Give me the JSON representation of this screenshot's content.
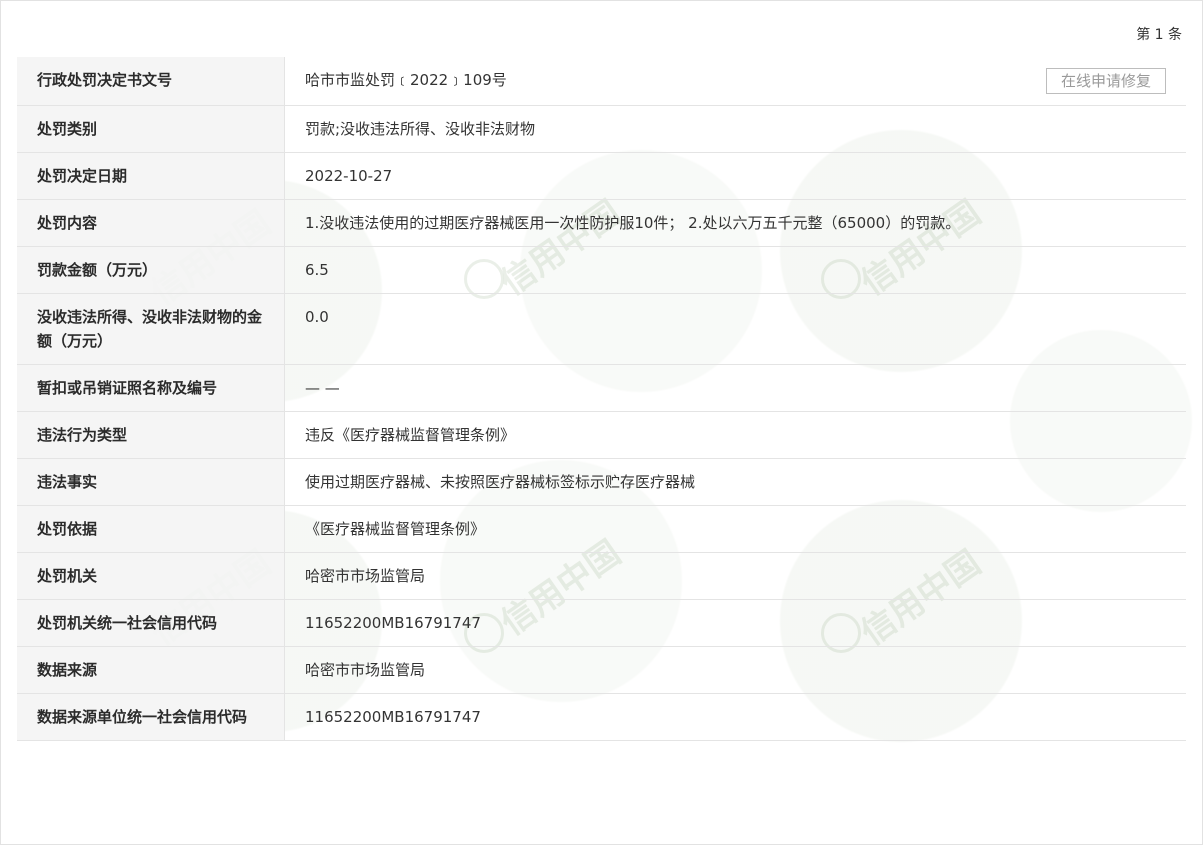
{
  "page_indicator": "第 1 条",
  "watermark_text": "信用中国",
  "repair_button_label": "在线申请修复",
  "rows": [
    {
      "label": "行政处罚决定书文号",
      "value": "哈市市监处罚﹝2022﹞109号"
    },
    {
      "label": "处罚类别",
      "value": "罚款;没收违法所得、没收非法财物"
    },
    {
      "label": "处罚决定日期",
      "value": "2022-10-27"
    },
    {
      "label": "处罚内容",
      "value": "1.没收违法使用的过期医疗器械医用一次性防护服10件； 2.处以六万五千元整（65000）的罚款。"
    },
    {
      "label": "罚款金额（万元）",
      "value": "6.5"
    },
    {
      "label": "没收违法所得、没收非法财物的金额（万元）",
      "value": "0.0"
    },
    {
      "label": "暂扣或吊销证照名称及编号",
      "value": "— —"
    },
    {
      "label": "违法行为类型",
      "value": "违反《医疗器械监督管理条例》"
    },
    {
      "label": "违法事实",
      "value": "使用过期医疗器械、未按照医疗器械标签标示贮存医疗器械"
    },
    {
      "label": "处罚依据",
      "value": "《医疗器械监督管理条例》"
    },
    {
      "label": "处罚机关",
      "value": "哈密市市场监管局"
    },
    {
      "label": "处罚机关统一社会信用代码",
      "value": "11652200MB16791747"
    },
    {
      "label": "数据来源",
      "value": "哈密市市场监管局"
    },
    {
      "label": "数据来源单位统一社会信用代码",
      "value": "11652200MB16791747"
    }
  ]
}
